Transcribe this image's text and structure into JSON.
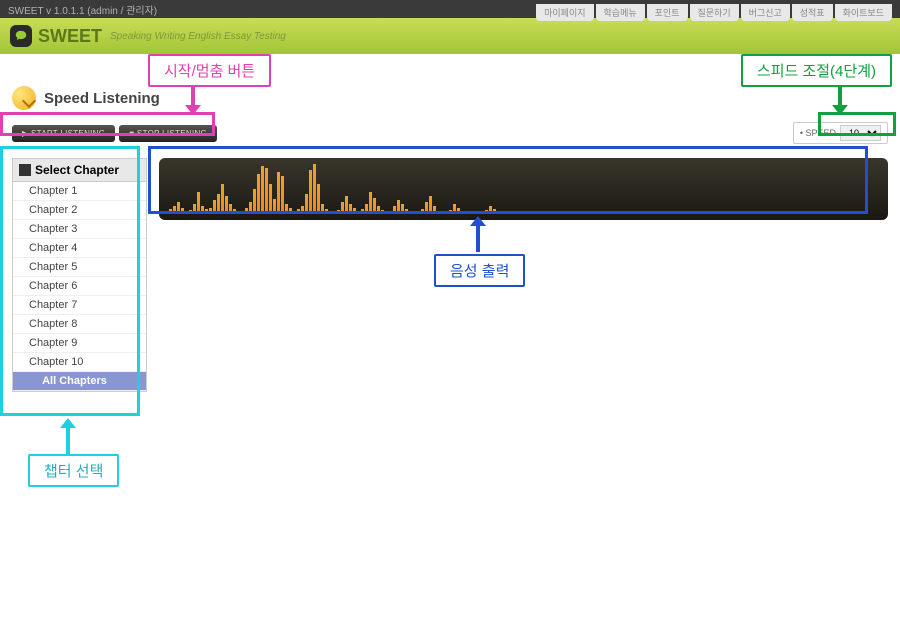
{
  "titlebar": {
    "text": "SWEET v 1.0.1.1 (admin / 관리자)"
  },
  "header": {
    "app_name": "SWEET",
    "subtitle": "Speaking Writing English Essay Testing",
    "nav": [
      "마이페이지",
      "학습메뉴",
      "포인트",
      "질문하기",
      "버그신고",
      "성적표",
      "화이트보드"
    ]
  },
  "page": {
    "title": "Speed Listening"
  },
  "controls": {
    "start_label": "▶ START LISTENING",
    "stop_label": "■ STOP LISTENING",
    "speed_label": "• SPEED",
    "speed_value": "10"
  },
  "sidebar": {
    "header": "Select Chapter",
    "chapters": [
      "Chapter 1",
      "Chapter 2",
      "Chapter 3",
      "Chapter 4",
      "Chapter 5",
      "Chapter 6",
      "Chapter 7",
      "Chapter 8",
      "Chapter 9",
      "Chapter 10"
    ],
    "all_label": "All Chapters"
  },
  "waveform": {
    "bars": [
      5,
      8,
      12,
      6,
      3,
      4,
      10,
      22,
      8,
      5,
      6,
      14,
      20,
      30,
      18,
      10,
      5,
      3,
      2,
      6,
      12,
      25,
      40,
      48,
      46,
      30,
      15,
      42,
      38,
      10,
      6,
      3,
      5,
      8,
      20,
      44,
      50,
      30,
      10,
      5,
      3,
      2,
      4,
      12,
      18,
      10,
      6,
      3,
      5,
      10,
      22,
      16,
      8,
      4,
      2,
      3,
      8,
      14,
      10,
      5,
      2,
      3,
      2,
      5,
      12,
      18,
      8,
      3,
      2,
      2,
      4,
      10,
      6,
      3,
      2,
      2,
      3,
      2,
      2,
      4,
      8,
      5,
      2,
      2,
      2,
      3,
      2,
      2,
      2,
      2,
      2,
      3,
      2,
      2,
      2,
      2,
      2,
      2,
      3,
      2,
      2,
      2,
      2,
      2,
      2,
      2,
      2,
      2,
      2,
      2,
      2,
      2,
      2,
      2,
      2,
      2,
      2,
      2,
      2,
      2,
      2,
      2,
      2,
      2,
      2,
      2,
      2,
      2,
      2,
      2,
      2,
      2,
      2,
      2,
      2,
      2,
      2,
      2,
      2,
      2,
      2,
      2,
      2,
      2,
      2,
      2,
      2,
      2,
      2,
      2
    ]
  },
  "callouts": {
    "play_stop": "시작/멈춤 버튼",
    "speed_adjust": "스피드 조절(4단계)",
    "audio_output": "음성 출력",
    "chapter_select": "챕터 선택"
  }
}
